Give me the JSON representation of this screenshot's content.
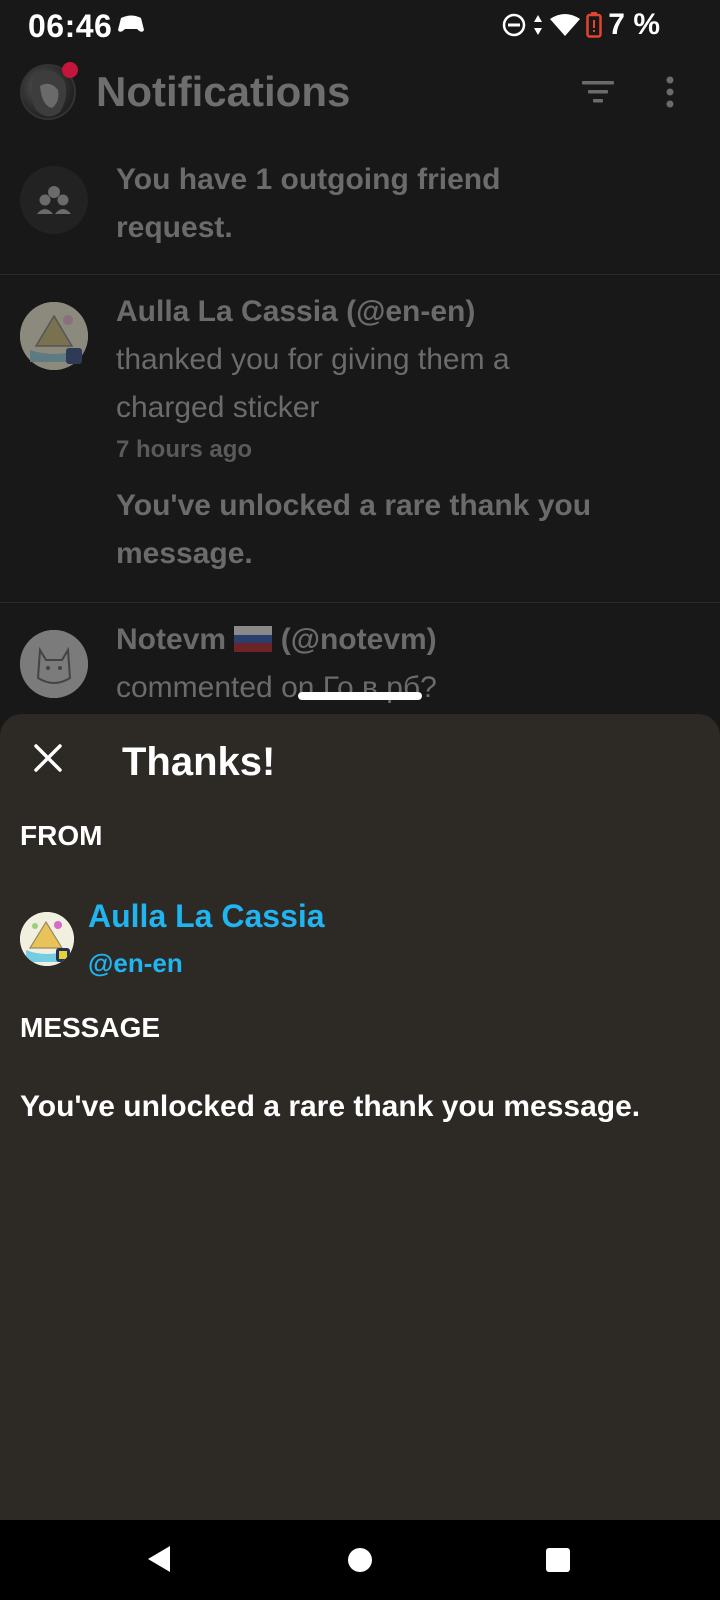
{
  "status_bar": {
    "time": "06:46",
    "battery": "7 %",
    "icons": [
      "gamepad-icon",
      "do-not-disturb-icon",
      "data-arrows-icon",
      "wifi-icon",
      "battery-low-icon"
    ]
  },
  "header": {
    "title": "Notifications",
    "icons": [
      "filter-icon",
      "more-vert-icon"
    ]
  },
  "notifications": {
    "friend_request": "You have 1 outgoing friend request.",
    "thanks": {
      "user": "Aulla La Cassia (@en-en)",
      "action": "thanked you for giving them a charged sticker",
      "time": "7 hours ago",
      "extra": "You've unlocked a rare thank you message."
    },
    "comment": {
      "user_name": "Notevm",
      "user_handle": "(@notevm)",
      "action": "commented on Го в рб?"
    }
  },
  "sheet": {
    "title": "Thanks!",
    "from_label": "FROM",
    "from_name": "Aulla La Cassia",
    "from_handle": "@en-en",
    "message_label": "MESSAGE",
    "message": "You've unlocked a rare thank you message."
  },
  "colors": {
    "accent": "#20b4f0",
    "sheet_bg": "#2d2925",
    "page_bg": "#181818",
    "notification_dot": "#c4163a",
    "battery_warning": "#e2442f"
  }
}
